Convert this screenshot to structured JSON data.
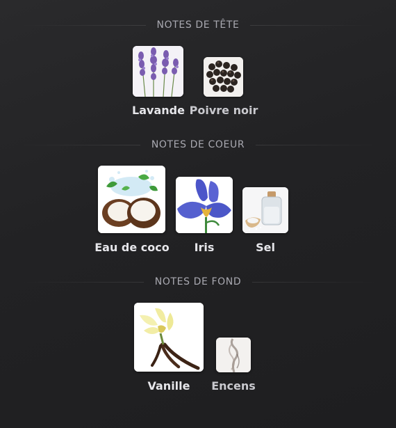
{
  "sections": [
    {
      "title": "NOTES DE TÊTE",
      "items": [
        {
          "name": "Lavande",
          "icon": "lavender-image"
        },
        {
          "name": "Poivre noir",
          "icon": "black-pepper-image"
        }
      ]
    },
    {
      "title": "NOTES DE COEUR",
      "items": [
        {
          "name": "Eau de coco",
          "icon": "coconut-water-image"
        },
        {
          "name": "Iris",
          "icon": "iris-flower-image"
        },
        {
          "name": "Sel",
          "icon": "salt-jar-image"
        }
      ]
    },
    {
      "title": "NOTES DE FOND",
      "items": [
        {
          "name": "Vanille",
          "icon": "vanilla-image"
        },
        {
          "name": "Encens",
          "icon": "incense-smoke-image"
        }
      ]
    }
  ]
}
